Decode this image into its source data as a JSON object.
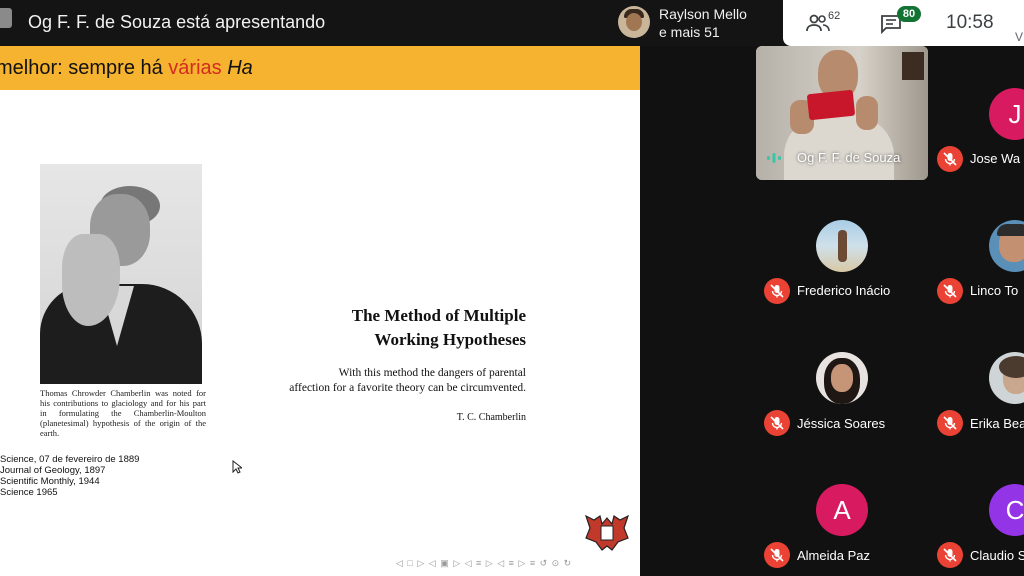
{
  "header": {
    "presenter_banner": "Og F. F. de Souza está apresentando",
    "viewer_name": "Raylson Mello",
    "viewer_more": "e mais 51",
    "participants_count": "62",
    "chat_count": "80",
    "clock": "10:58",
    "clock_extra": "V"
  },
  "slide": {
    "title_prefix": "melhor: sempre há ",
    "title_accent": "várias",
    "title_italic": "Ha",
    "caption": "Thomas Chrowder Chamberlin was noted for his contributions to glaciology and for his part in formulating the Chamberlin-Moulton (planetesimal) hypothesis of the origin of the earth.",
    "references": [
      "Science, 07 de fevereiro de 1889",
      "Journal of Geology, 1897",
      "Scientific Monthly, 1944",
      "Science 1965"
    ],
    "paper_title_line1": "The Method of Multiple",
    "paper_title_line2": "Working Hypotheses",
    "paper_subtitle_line1": "With this method the dangers of parental",
    "paper_subtitle_line2": "affection for a favorite theory can be circumvented.",
    "paper_author": "T. C. Chamberlin",
    "nav_controls": "◁ □ ▷ ◁ ▣ ▷ ◁ ≡ ▷ ◁ ≡ ▷   ≡   ↺ ⊙ ↻"
  },
  "participants": [
    {
      "name": "Og F. F. de Souza",
      "type": "video",
      "speaking": true
    },
    {
      "name": "Jose Wa",
      "type": "letter",
      "letter": "J",
      "color": "#d81b60"
    },
    {
      "name": "Frederico Inácio",
      "type": "photo"
    },
    {
      "name": "Linco To",
      "type": "photo"
    },
    {
      "name": "Jéssica Soares",
      "type": "photo"
    },
    {
      "name": "Erika Bea",
      "type": "photo"
    },
    {
      "name": "Almeida Paz",
      "type": "letter",
      "letter": "A",
      "color": "#d81b60"
    },
    {
      "name": "Claudio S",
      "type": "letter",
      "letter": "C",
      "color": "#9334e6"
    }
  ],
  "colors": {
    "slide_band": "#f6b330",
    "title_accent": "#d32d1f",
    "mic_off": "#ea4335",
    "chat_badge": "#137333"
  }
}
